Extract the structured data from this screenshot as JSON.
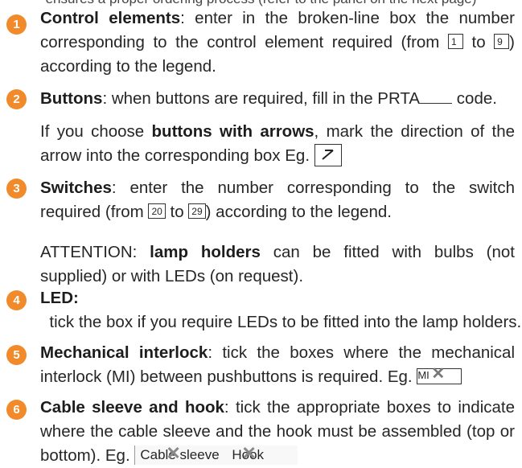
{
  "colors": {
    "badge": "#f08a2a",
    "text": "#262626"
  },
  "top_text": "ensures a proper ordering process (refer to the panel on the next page)",
  "items": [
    {
      "num": "1",
      "title": "Control elements",
      "text_a": ": enter in the broken-line box the number corresponding to the control element required (from ",
      "box_a": "1",
      "text_b": " to ",
      "box_b": "9",
      "text_c": ") according to the legend."
    },
    {
      "num": "2",
      "title": "Buttons",
      "text_a": ": when buttons are required, fill in the PRTA",
      "text_b": " code.",
      "sub_text_a": "If you choose ",
      "sub_bold": "buttons with arrows",
      "sub_text_b": ", mark the direction of the arrow into the corresponding box Eg.",
      "arrow_icon": "diagonal-arrow-icon"
    },
    {
      "num": "3",
      "title": "Switches",
      "text_a": ": enter the number corresponding to the switch required (from ",
      "box_a": "20",
      "text_b": " to ",
      "box_b": "29",
      "text_c": ") according to the legend.",
      "attention_a": "ATTENTION: ",
      "attention_bold": "lamp holders",
      "attention_b": " can be fitted with bulbs (not supplied) or with LEDs (on request)."
    },
    {
      "num": "4",
      "title": "LED:",
      "text_a": "  tick the box if you require LEDs to be fitted into the lamp holders."
    },
    {
      "num": "5",
      "title": "Mechanical interlock",
      "text_a": ": tick the boxes where the mechanical interlock (MI) between pushbuttons is required. Eg.",
      "example": "MI"
    },
    {
      "num": "6",
      "title": "Cable sleeve and hook",
      "text_a": ": tick the appropriate boxes to indicate where the cable sleeve and the hook must be assembled (top or bottom). Eg.",
      "example_a": "Cable sleeve",
      "example_b": "Hook"
    }
  ]
}
